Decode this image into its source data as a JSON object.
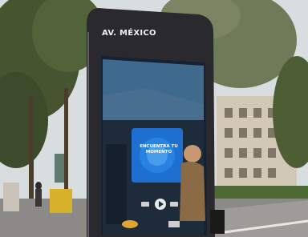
{
  "kiosk": {
    "brand": "AV. MÉXICO"
  },
  "ad": {
    "headline_line1": "",
    "headline_line2": "",
    "podcast_title": "ENCUENTRA TU\nMOMENTO"
  },
  "colors": {
    "kiosk_frame": "#2a2a2e",
    "screen_sky": "#3f6a8e",
    "podcast_tile": "#1e6fd0",
    "trees": "#3f4f2e",
    "pavement": "#8c8a86"
  },
  "icons": [
    "play-icon",
    "logo-mark"
  ]
}
